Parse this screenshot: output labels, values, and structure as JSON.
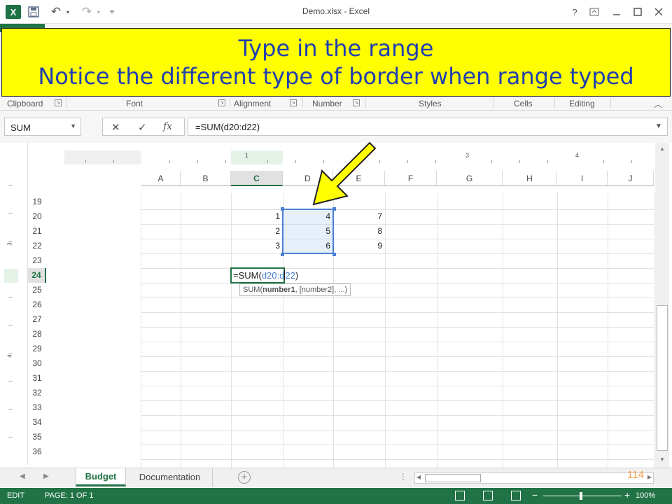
{
  "window": {
    "title": "Demo.xlsx - Excel",
    "app_icon": "X",
    "icons": [
      "excel-icon",
      "save-icon",
      "undo-icon",
      "redo-icon",
      "help-icon",
      "ribbon-display-icon",
      "minimize-icon",
      "maximize-icon",
      "close-icon"
    ],
    "help": "?"
  },
  "callout": {
    "line1": "Type in the range",
    "line2": "Notice the different type of border when range typed",
    "background": "#ffff00",
    "text_color": "#1f3fb0"
  },
  "ribbon": {
    "groups": [
      "Clipboard",
      "Font",
      "Alignment",
      "Number",
      "Styles",
      "Cells",
      "Editing"
    ]
  },
  "formula_bar": {
    "name_box": "SUM",
    "formula": "=SUM(d20:d22)",
    "fx_label": "fx"
  },
  "ruler": {
    "h_numbers": [
      "1",
      "3",
      "4"
    ],
    "v_numbers": [
      "3",
      "4"
    ]
  },
  "sheet": {
    "columns": [
      "A",
      "B",
      "C",
      "D",
      "E",
      "F",
      "G",
      "H",
      "I",
      "J"
    ],
    "selected_column": "C",
    "rows": [
      "19",
      "20",
      "21",
      "22",
      "23",
      "24",
      "25",
      "26",
      "27",
      "28",
      "29",
      "30",
      "31",
      "32",
      "33",
      "34",
      "35",
      "36"
    ],
    "selected_row": "24",
    "cells": {
      "C20": "1",
      "C21": "2",
      "C22": "3",
      "D20": "4",
      "D21": "5",
      "D22": "6",
      "E20": "7",
      "E21": "8",
      "E22": "9"
    },
    "active_cell": {
      "prefix": "=SUM(",
      "ref_start": "d20:d",
      "ref_end": "22",
      "suffix": ")"
    },
    "tooltip": {
      "name": "SUM(",
      "bold_arg": "number1",
      "rest": ", [number2], ...)"
    }
  },
  "tabs": {
    "active": "Budget",
    "other": "Documentation",
    "add": "+",
    "dots": "⋮"
  },
  "slide_number": "114",
  "status": {
    "mode": "EDIT",
    "page": "PAGE: 1 OF 1",
    "zoom_minus": "−",
    "zoom_plus": "+",
    "zoom": "100%"
  },
  "colors": {
    "excel_green": "#217346",
    "range_blue": "#4a80d6",
    "arrow_fill": "#ffff00"
  }
}
